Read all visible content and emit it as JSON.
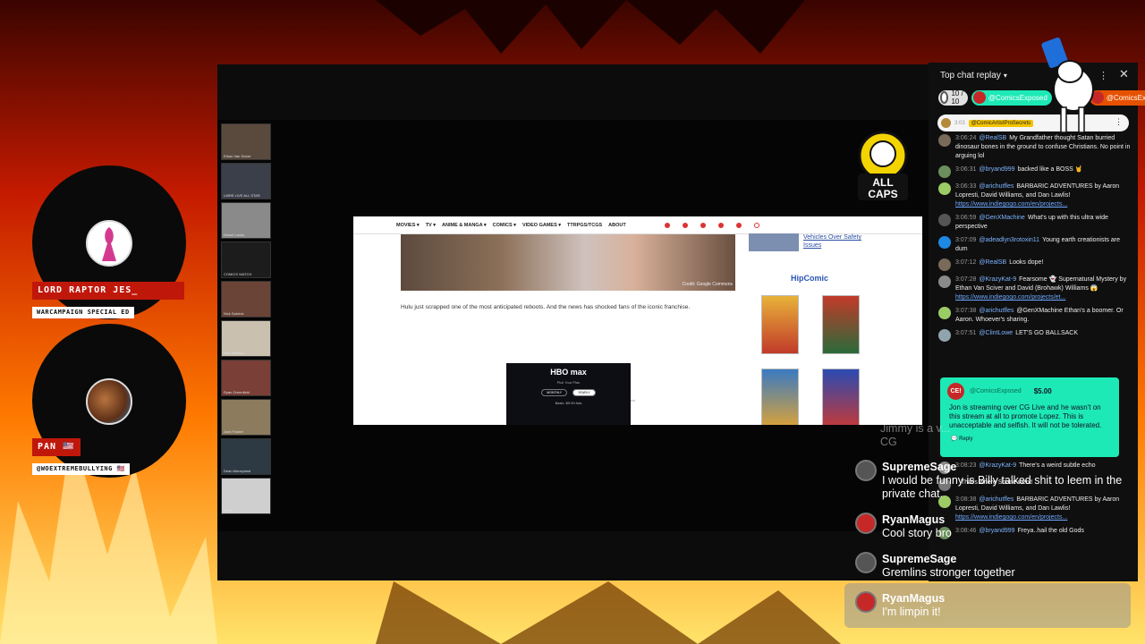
{
  "guests": [
    {
      "name": "LORD RAPTOR JES_",
      "tag": "WARCAMPAIGN SPECIAL ED"
    },
    {
      "name": "PAN 🇺🇸",
      "tag": "@WOEXTREMEBULLYING 🇺🇸"
    }
  ],
  "stream_thumbs": [
    "Ethan Van Sciver",
    "LIBRE LIVE ALL STAR",
    "Diesel Lando",
    "COMICS WATCH",
    "Nick Sabrink",
    "Nick Wallsky",
    "Ryan Greenfield",
    "Josh Frazier",
    "Dean Moneyland",
    "Ethan"
  ],
  "site": {
    "logo_text": "ALL CAPS COMICS",
    "nav": [
      "MOVIES ▾",
      "TV ▾",
      "ANIME & MANGA ▾",
      "COMICS ▾",
      "VIDEO GAMES ▾",
      "TTRPGS/TCGS",
      "ABOUT"
    ],
    "hero_credit": "Credit: Google Commons",
    "article_text": "Hulu just scrapped one of the most anticipated reboots. And the news has shocked fans of the iconic franchise.",
    "advertisement": "advertisement",
    "side_headline": "Vehicles Over Safety Issues",
    "side_ad_logo": "HipComic",
    "hbo": {
      "logo": "HBO max",
      "subtitle": "Pick Your Plan",
      "btn_a": "MONTHLY",
      "btn_b": "YEARLY",
      "plan": "Basic: $9.99 Ads"
    }
  },
  "chat": {
    "title": "Top chat replay",
    "tickers": [
      {
        "label": "10 / 10"
      },
      {
        "label": "@ComicsExposed"
      },
      {
        "label": "@ComicsExp…"
      }
    ],
    "pinned": {
      "time": "3:03",
      "author": "@ComicArtistProSecrets"
    },
    "messages": [
      {
        "time": "3:06:24",
        "author": "@RealSB",
        "text": "My Grandfather thought Satan burried dinosaur bones in the ground to confuse Christians. No point in arguing lol",
        "color": "#7a6a5a"
      },
      {
        "time": "3:06:31",
        "author": "@bryand999",
        "text": "backed like a BOSS 🤘",
        "color": "#6b8f5c"
      },
      {
        "time": "3:06:33",
        "author": "@arichutfles",
        "text": "BARBARIC ADVENTURES by Aaron Lopresti, David Williams, and Dan Lawlis!",
        "link": "https://www.indiegogo.com/en/projects...",
        "color": "#9ccc65"
      },
      {
        "time": "3:06:59",
        "author": "@GenXMachine",
        "text": "What's up with this ultra wide perspective",
        "color": "#555"
      },
      {
        "time": "3:07:09",
        "author": "@adeadlyn3rotoxin11",
        "text": "Young earth creationists are dum",
        "color": "#1e88e5"
      },
      {
        "time": "3:07:12",
        "author": "@RealSB",
        "text": "Looks dope!",
        "color": "#7a6a5a"
      },
      {
        "time": "3:07:28",
        "author": "@KrazyKat-9",
        "text": "Fearsome 👻 Supernatural Mystery by Ethan Van Sciver and David (Brohawk) Williams 😱",
        "link": "https://www.indiegogo.com/projects/et...",
        "color": "#8a8a8a"
      },
      {
        "time": "3:07:38",
        "author": "@arichutfles",
        "text": "@GenXMachine Ethan's a boomer. Or Aaron. Whoever's sharing.",
        "color": "#9ccc65"
      },
      {
        "time": "3:07:51",
        "author": "@ClintLowe",
        "text": "LET'S GO BALLSACK",
        "color": "#90a4ae"
      }
    ],
    "superchat": {
      "author": "@ComicsExposed",
      "amount": "$5.00",
      "text": "Jon is streaming over CG Live and he wasn't on this stream at all to promote Lopez. This is unacceptable and selfish. It will not be tolerated.",
      "reply": "Reply"
    },
    "messages_after": [
      {
        "time": "3:08:23",
        "author": "@KrazyKat-9",
        "text": "There's a weird subtle echo",
        "color": "#8a8a8a"
      },
      {
        "time": "",
        "author": "",
        "text": "That's where Shane went!",
        "color": "#777"
      },
      {
        "time": "3:08:38",
        "author": "@arichutfles",
        "text": "BARBARIC ADVENTURES by Aaron Lopresti, David Williams, and Dan Lawlis!",
        "link": "https://www.indiegogo.com/en/projects...",
        "color": "#9ccc65"
      },
      {
        "time": "3:08:46",
        "author": "@bryand999",
        "text": "Freya..hail the old Gods",
        "color": "#6b8f5c"
      }
    ]
  },
  "overlay_chat": [
    {
      "name": "",
      "text": "Jimmy is a v... CG"
    },
    {
      "name": "SupremeSage",
      "text": "I would be funny is Billy talked shit to leem in the private chat."
    },
    {
      "name": "RyanMagus",
      "text": "Cool story bro"
    },
    {
      "name": "SupremeSage",
      "text": "Gremlins stronger together"
    },
    {
      "name": "RyanMagus",
      "text": "I'm limpin it!"
    }
  ],
  "colors": {
    "accent_red": "#c0170b",
    "superchat": "#1de9b6",
    "pinned_badge": "#f4c400"
  }
}
